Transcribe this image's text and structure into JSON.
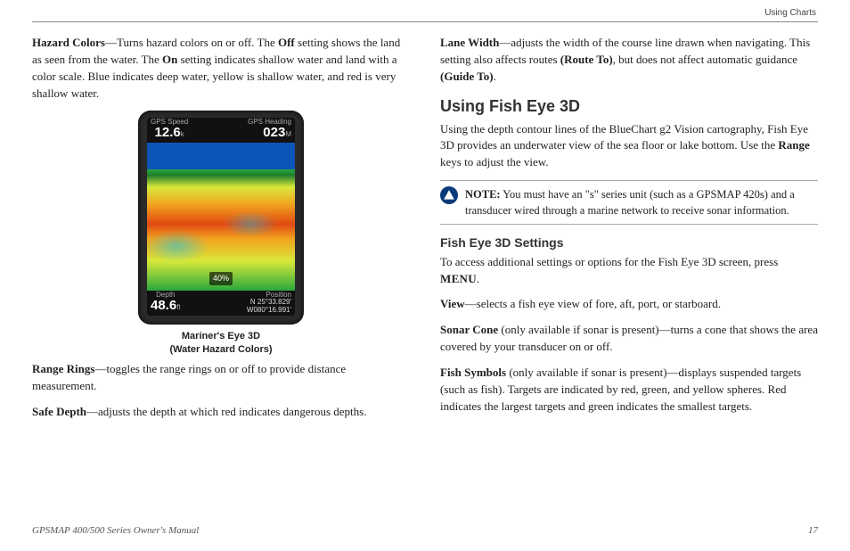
{
  "header_label": "Using Charts",
  "left": {
    "hazard_label": "Hazard Colors",
    "hazard_body_1": "—Turns hazard colors on or off. The ",
    "off": "Off",
    "hazard_body_2": " setting shows the land as seen from the water. The ",
    "on": "On",
    "hazard_body_3": " setting indicates shallow water and land with a color scale. Blue indicates deep water, yellow is shallow water, and red is very shallow water.",
    "device": {
      "gps_speed_label": "GPS Speed",
      "gps_speed_val": "12.6",
      "gps_speed_unit": "k",
      "gps_heading_label": "GPS Heading",
      "gps_heading_val": "023",
      "gps_heading_unit": "M",
      "pct": "40%",
      "depth_label": "Depth",
      "depth_val": "48.6",
      "depth_unit": "ft",
      "position_label": "Position",
      "lat": "N  25°33.829'",
      "lon": "W080°16.991'"
    },
    "caption_l1": "Mariner's Eye 3D",
    "caption_l2": "(Water Hazard Colors)",
    "range_label": "Range Rings",
    "range_body": "—toggles the range rings on or off to provide distance measurement.",
    "safe_label": "Safe Depth",
    "safe_body": "—adjusts the depth at which red indicates dangerous depths."
  },
  "right": {
    "lane_label": "Lane Width",
    "lane_body_1": "—adjusts the width of the course line drawn when navigating. This setting also affects routes ",
    "route_to": "(Route To)",
    "lane_body_2": ", but does not affect automatic guidance ",
    "guide_to": "(Guide To)",
    "lane_body_3": ".",
    "h2": "Using Fish Eye 3D",
    "intro_1": "Using the depth contour lines of the BlueChart g2 Vision cartography, Fish Eye 3D provides an underwater view of the sea floor or lake bottom. Use the ",
    "range": "Range",
    "intro_2": " keys to adjust the view.",
    "note_label": "NOTE:",
    "note_body": " You must have an \"s\" series unit (such as a GPSMAP 420s) and a transducer wired through a marine network to receive sonar information.",
    "h3": "Fish Eye 3D Settings",
    "settings_intro_1": "To access additional settings or options for the Fish Eye 3D screen, press ",
    "menu": "MENU",
    "settings_intro_2": ".",
    "view_label": "View",
    "view_body": "—selects a fish eye view of fore, aft, port, or starboard.",
    "sonar_label": "Sonar Cone",
    "sonar_qual": " (only available if sonar is present)—turns a cone that shows the area covered by your transducer on or off.",
    "fish_label": "Fish Symbols",
    "fish_qual": " (only available if sonar is present)—displays suspended targets (such as fish). Targets are indicated by red, green, and yellow spheres. Red indicates the largest targets and green indicates the smallest targets."
  },
  "footer": {
    "manual": "GPSMAP 400/500 Series Owner's Manual",
    "page": "17"
  }
}
